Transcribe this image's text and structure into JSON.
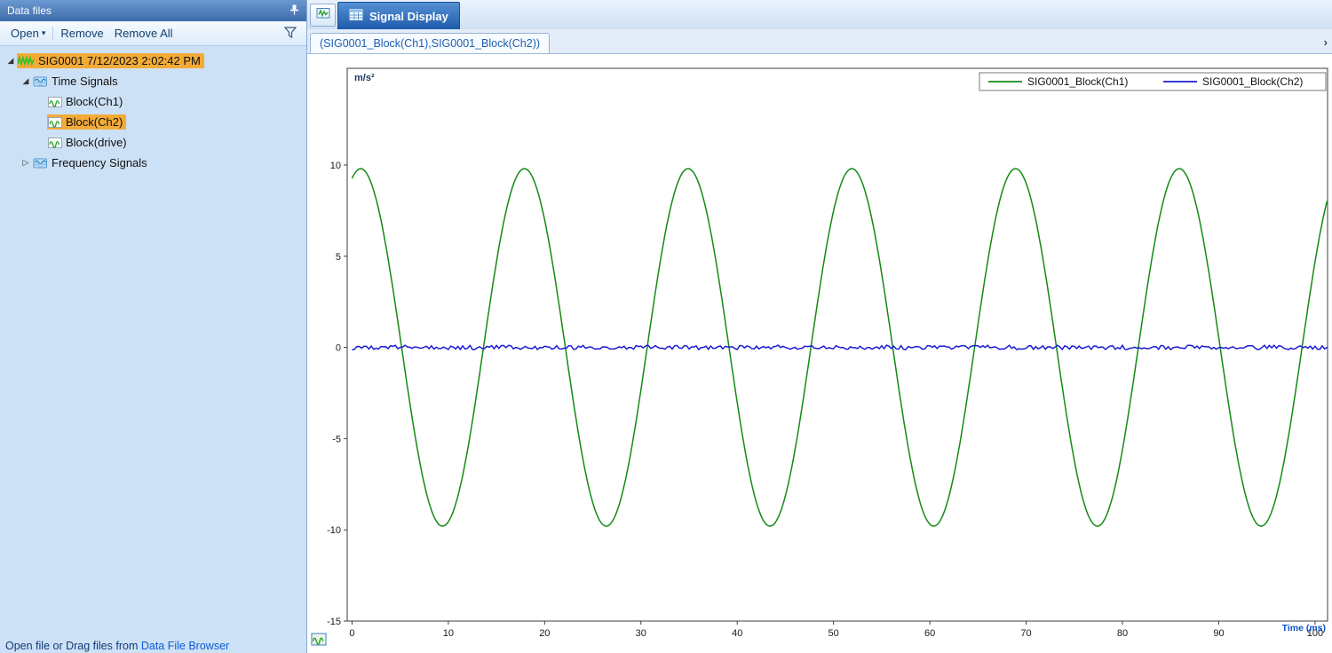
{
  "left_panel": {
    "title": "Data files",
    "toolbar": {
      "open": "Open",
      "remove": "Remove",
      "remove_all": "Remove All"
    },
    "tree": [
      {
        "label": "SIG0001 7/12/2023 2:02:42 PM",
        "level": 0,
        "icon": "signal-file",
        "expanded": true,
        "highlighted": true
      },
      {
        "label": "Time Signals",
        "level": 1,
        "icon": "signals-folder",
        "expanded": true,
        "highlighted": false
      },
      {
        "label": "Block(Ch1)",
        "level": 2,
        "icon": "block-signal",
        "highlighted": false
      },
      {
        "label": "Block(Ch2)",
        "level": 2,
        "icon": "block-signal",
        "highlighted": true
      },
      {
        "label": "Block(drive)",
        "level": 2,
        "icon": "block-signal",
        "highlighted": false
      },
      {
        "label": "Frequency Signals",
        "level": 1,
        "icon": "signals-folder",
        "expanded": false,
        "highlighted": false
      }
    ],
    "footer_text": "Open file or Drag files from",
    "footer_link": "Data File Browser"
  },
  "tab_bar": {
    "active_tab": "Signal Display"
  },
  "document_tab": "(SIG0001_Block(Ch1),SIG0001_Block(Ch2))",
  "chart_data": {
    "type": "line",
    "title": "",
    "ylabel": "m/s²",
    "xlabel": "Time (ms)",
    "xlim": [
      -0.5,
      101.3
    ],
    "ylim": [
      -15,
      15.3
    ],
    "x_ticks": [
      0,
      10,
      20,
      30,
      40,
      50,
      60,
      70,
      80,
      90,
      100
    ],
    "y_ticks": [
      10,
      5,
      0,
      -5,
      -10,
      -15
    ],
    "grid": false,
    "legend_position": "top-right",
    "series": [
      {
        "name": "SIG0001_Block(Ch1)",
        "color": "#158a15",
        "waveform": "sine",
        "amplitude": 9.8,
        "period_ms": 17.0,
        "peak_at_ms": 0.9,
        "x_start": 0,
        "x_end": 101.3
      },
      {
        "name": "SIG0001_Block(Ch2)",
        "color": "#1c1cd4",
        "waveform": "noise",
        "mean": 0,
        "noise_amplitude": 0.12,
        "x_start": 0,
        "x_end": 101.3
      }
    ]
  }
}
